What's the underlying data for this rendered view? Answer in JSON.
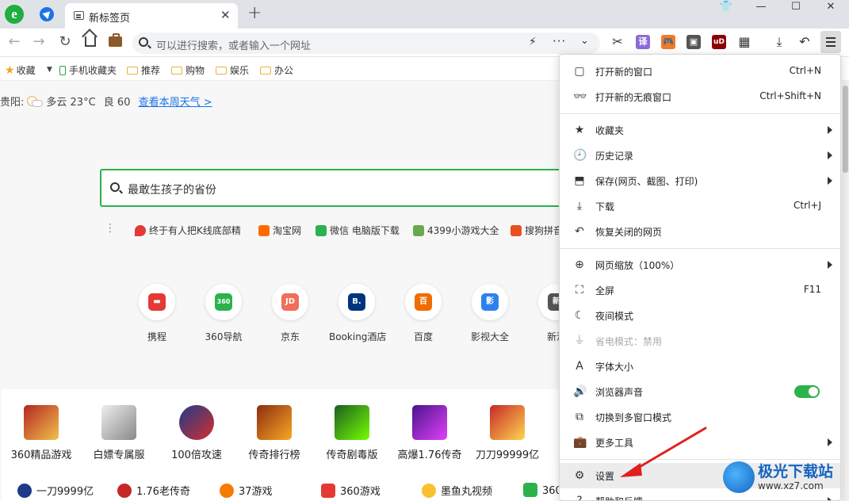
{
  "tab": {
    "title": "新标签页",
    "close": "✕"
  },
  "newtab_label": "+",
  "window": {
    "shirt": "👕",
    "minimize": "—",
    "maximize": "☐",
    "close": "✕"
  },
  "omnibox": {
    "placeholder": "可以进行搜索，或者输入一个网址",
    "bolt": "⚡",
    "dots": "···",
    "chevron": "⌄"
  },
  "extensions": [
    {
      "name": "scissors-icon",
      "glyph": "✂",
      "color": ""
    },
    {
      "name": "translate-icon",
      "glyph": "译",
      "color": "#8e6bd6"
    },
    {
      "name": "game-icon",
      "glyph": "🎮",
      "color": "#f07b2b"
    },
    {
      "name": "reader-icon",
      "glyph": "▣",
      "color": "#555555"
    },
    {
      "name": "ublock-icon",
      "glyph": "uD",
      "color": "#8b0000"
    },
    {
      "name": "apps-icon",
      "glyph": "▦",
      "color": ""
    }
  ],
  "toolbar_glyphs": {
    "back": "←",
    "forward": "→",
    "reload": "↻",
    "download": "⤓",
    "undo": "↶"
  },
  "bookmarks": {
    "favorites": "收藏",
    "items": [
      "手机收藏夹",
      "推荐",
      "购物",
      "娱乐",
      "办公"
    ]
  },
  "weather": {
    "city": "贵阳:",
    "cond": "多云 23°C",
    "aqi": "良 60",
    "link": "查看本周天气 >"
  },
  "search": {
    "query": "最敢生孩子的省份"
  },
  "hotwords": [
    {
      "text": "终于有人把K线底部精",
      "color": "#e53935"
    },
    {
      "text": "淘宝网",
      "color": "#ff6a00"
    },
    {
      "text": "微信 电脑版下载",
      "color": "#2bb24c"
    },
    {
      "text": "4399小游戏大全",
      "color": "#6aa84f"
    },
    {
      "text": "搜狗拼音",
      "color": "#e8501f"
    }
  ],
  "sites": [
    {
      "label": "携程",
      "abbr": "▬",
      "color": "#e53935"
    },
    {
      "label": "360导航",
      "abbr": "360",
      "color": "#2bb24c"
    },
    {
      "label": "京东",
      "abbr": "JD",
      "color": "#f26d5b"
    },
    {
      "label": "Booking酒店",
      "abbr": "B.",
      "color": "#003580"
    },
    {
      "label": "百度",
      "abbr": "百",
      "color": "#ef6c00"
    },
    {
      "label": "影视大全",
      "abbr": "影",
      "color": "#2f80ed"
    },
    {
      "label": "新浪",
      "abbr": "新",
      "color": "#555555"
    }
  ],
  "games": [
    {
      "label": "360精品游戏",
      "color": "#b3261e"
    },
    {
      "label": "白嫖专属服",
      "color": "#9e9e9e"
    },
    {
      "label": "100倍攻速",
      "color": "#1e3a8a"
    },
    {
      "label": "传奇排行榜",
      "color": "#8d2d0e"
    },
    {
      "label": "传奇剧毒版",
      "color": "#2e7d32"
    },
    {
      "label": "高爆1.76传奇",
      "color": "#7b1fa2"
    },
    {
      "label": "刀刀99999亿",
      "color": "#c62828"
    }
  ],
  "game_links": [
    {
      "text": "一刀9999亿",
      "color": "#1e3a8a"
    },
    {
      "text": "1.76老传奇",
      "color": "#c62828"
    },
    {
      "text": "37游戏",
      "color": "#f57c00"
    },
    {
      "text": "360游戏",
      "color": "#e53935"
    },
    {
      "text": "墨鱼丸视频",
      "color": "#fbc02d"
    },
    {
      "text": "360",
      "color": "#2bb24c"
    }
  ],
  "menu": {
    "new_window": {
      "label": "打开新的窗口",
      "shortcut": "Ctrl+N",
      "icon": "▢"
    },
    "new_incognito": {
      "label": "打开新的无痕窗口",
      "shortcut": "Ctrl+Shift+N",
      "icon": "👓"
    },
    "favorites": {
      "label": "收藏夹",
      "icon": "★"
    },
    "history": {
      "label": "历史记录",
      "icon": "🕘"
    },
    "save": {
      "label": "保存(网页、截图、打印)",
      "icon": "⬒"
    },
    "download": {
      "label": "下载",
      "shortcut": "Ctrl+J",
      "icon": "⤓"
    },
    "restore": {
      "label": "恢复关闭的网页",
      "icon": "↶"
    },
    "zoom": {
      "label": "网页缩放（100%）",
      "icon": "⊕"
    },
    "fullscreen": {
      "label": "全屏",
      "shortcut": "F11",
      "icon": "⛶"
    },
    "night": {
      "label": "夜间模式",
      "icon": "☾"
    },
    "power_save": {
      "label": "省电模式：禁用",
      "icon": "⏚"
    },
    "font_size": {
      "label": "字体大小",
      "icon": "A"
    },
    "sound": {
      "label": "浏览器声音",
      "icon": "🔊",
      "enabled": true
    },
    "multi_window": {
      "label": "切换到多窗口模式",
      "icon": "⧉"
    },
    "more_tools": {
      "label": "更多工具",
      "icon": "💼"
    },
    "settings": {
      "label": "设置",
      "icon": "⚙"
    },
    "help": {
      "label": "帮助和反馈",
      "icon": "?"
    }
  },
  "watermark": {
    "title": "极光下载站",
    "url": "www.xz7.com"
  },
  "colors": {
    "accent_green": "#2bb24c",
    "annotation_red": "#e02020",
    "link_blue": "#1a73e8"
  }
}
